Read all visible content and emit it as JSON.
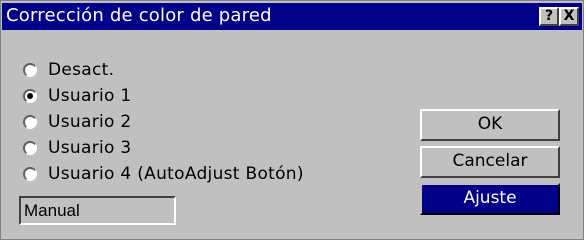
{
  "dialog": {
    "title": "Corrección de color de pared",
    "help_label": "?",
    "close_label": "X"
  },
  "options": [
    {
      "label": "Desact.",
      "selected": false
    },
    {
      "label": "Usuario 1",
      "selected": true
    },
    {
      "label": "Usuario 2",
      "selected": false
    },
    {
      "label": "Usuario 3",
      "selected": false
    },
    {
      "label": "Usuario 4 (AutoAdjust Botón)",
      "selected": false
    }
  ],
  "mode_field": {
    "value": "Manual"
  },
  "buttons": {
    "ok_label": "OK",
    "cancel_label": "Cancelar",
    "adjust_label": "Ajuste"
  },
  "colors": {
    "titlebar": "#00008a",
    "face": "#c0c0c0",
    "highlight_button": "#00008a"
  }
}
